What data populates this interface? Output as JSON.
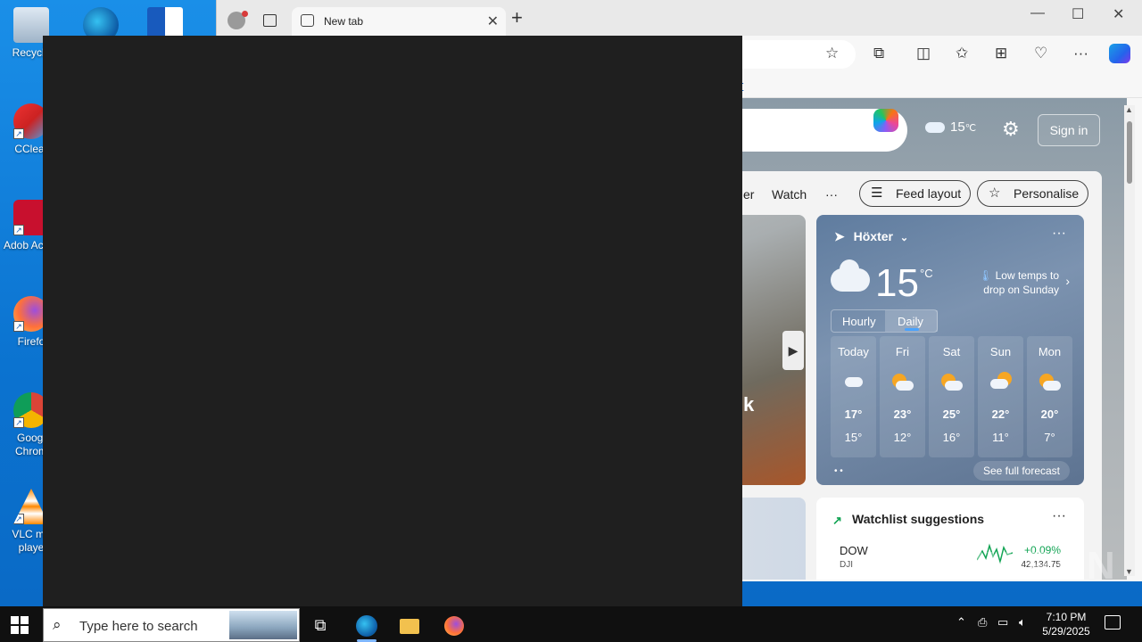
{
  "desktop": {
    "icons": [
      {
        "label": "Recycle"
      },
      {
        "label": "CClear"
      },
      {
        "label": "Adob Acrob"
      },
      {
        "label": "Firefo"
      },
      {
        "label": "Googl Chrom"
      },
      {
        "label": "VLC me playe"
      }
    ]
  },
  "browser": {
    "tab_title": "New tab",
    "new_tab_symbol": "+",
    "close_symbol": "✕",
    "window_controls": {
      "minimize": "—",
      "maximize": "☐",
      "close": "✕"
    },
    "toolbar_icons": [
      "star-icon",
      "extensions-icon",
      "split-screen-icon",
      "favorites-icon",
      "collections-icon",
      "browser-essentials-icon",
      "more-icon",
      "copilot-icon"
    ]
  },
  "newtab": {
    "header_weather_temp": "15",
    "header_weather_unit": "℃",
    "sign_in": "Sign in",
    "nav": [
      "er",
      "Watch",
      "···"
    ],
    "feed_layout": "Feed layout",
    "personalise": "Personalise",
    "hero_text": "k"
  },
  "weather": {
    "location": "Höxter",
    "temp": "15",
    "unit": "°C",
    "alert": "Low temps to drop on Sunday",
    "tabs": {
      "hourly": "Hourly",
      "daily": "Daily"
    },
    "days": [
      {
        "name": "Today",
        "high": "17°",
        "low": "15°",
        "icon": "cloudy-icon"
      },
      {
        "name": "Fri",
        "high": "23°",
        "low": "12°",
        "icon": "partly-sunny-icon"
      },
      {
        "name": "Sat",
        "high": "25°",
        "low": "16°",
        "icon": "partly-sunny-icon"
      },
      {
        "name": "Sun",
        "high": "22°",
        "low": "11°",
        "icon": "rain-sun-icon"
      },
      {
        "name": "Mon",
        "high": "20°",
        "low": "7°",
        "icon": "partly-sunny-icon"
      }
    ],
    "see_full": "See full forecast",
    "more": "···"
  },
  "watchlist": {
    "title": "Watchlist suggestions",
    "more": "···",
    "stock": {
      "name": "DOW",
      "symbol": "DJI",
      "change": "+0.09%",
      "value": "42,134.75"
    }
  },
  "watermark": "ANY RUN",
  "taskbar": {
    "search_placeholder": "Type here to search",
    "time": "7:10 PM",
    "date": "5/29/2025"
  },
  "colors": {
    "desktop": "#0a78d4",
    "overlay": "#1f1f1f",
    "taskbar": "#101010",
    "positive": "#12a454"
  }
}
